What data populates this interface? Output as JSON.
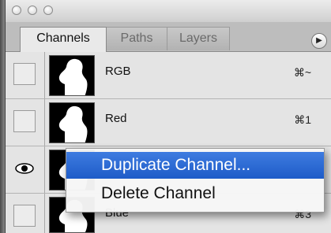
{
  "window": {
    "traffic_lights": [
      "close",
      "minimize",
      "zoom"
    ]
  },
  "tabs": [
    {
      "label": "Channels",
      "active": true
    },
    {
      "label": "Paths",
      "active": false
    },
    {
      "label": "Layers",
      "active": false
    }
  ],
  "panel_menu_icon": "triangle-right-icon",
  "channels": [
    {
      "name": "RGB",
      "shortcut": "⌘~",
      "visible": false
    },
    {
      "name": "Red",
      "shortcut": "⌘1",
      "visible": false
    },
    {
      "name": "",
      "shortcut": "",
      "visible": true
    },
    {
      "name": "Blue",
      "shortcut": "⌘3",
      "visible": false
    }
  ],
  "context_menu": {
    "items": [
      {
        "label": "Duplicate Channel...",
        "highlighted": true
      },
      {
        "label": "Delete Channel",
        "highlighted": false
      }
    ]
  },
  "colors": {
    "highlight": "#2a66d2",
    "panel_bg": "#e4e4e4"
  }
}
